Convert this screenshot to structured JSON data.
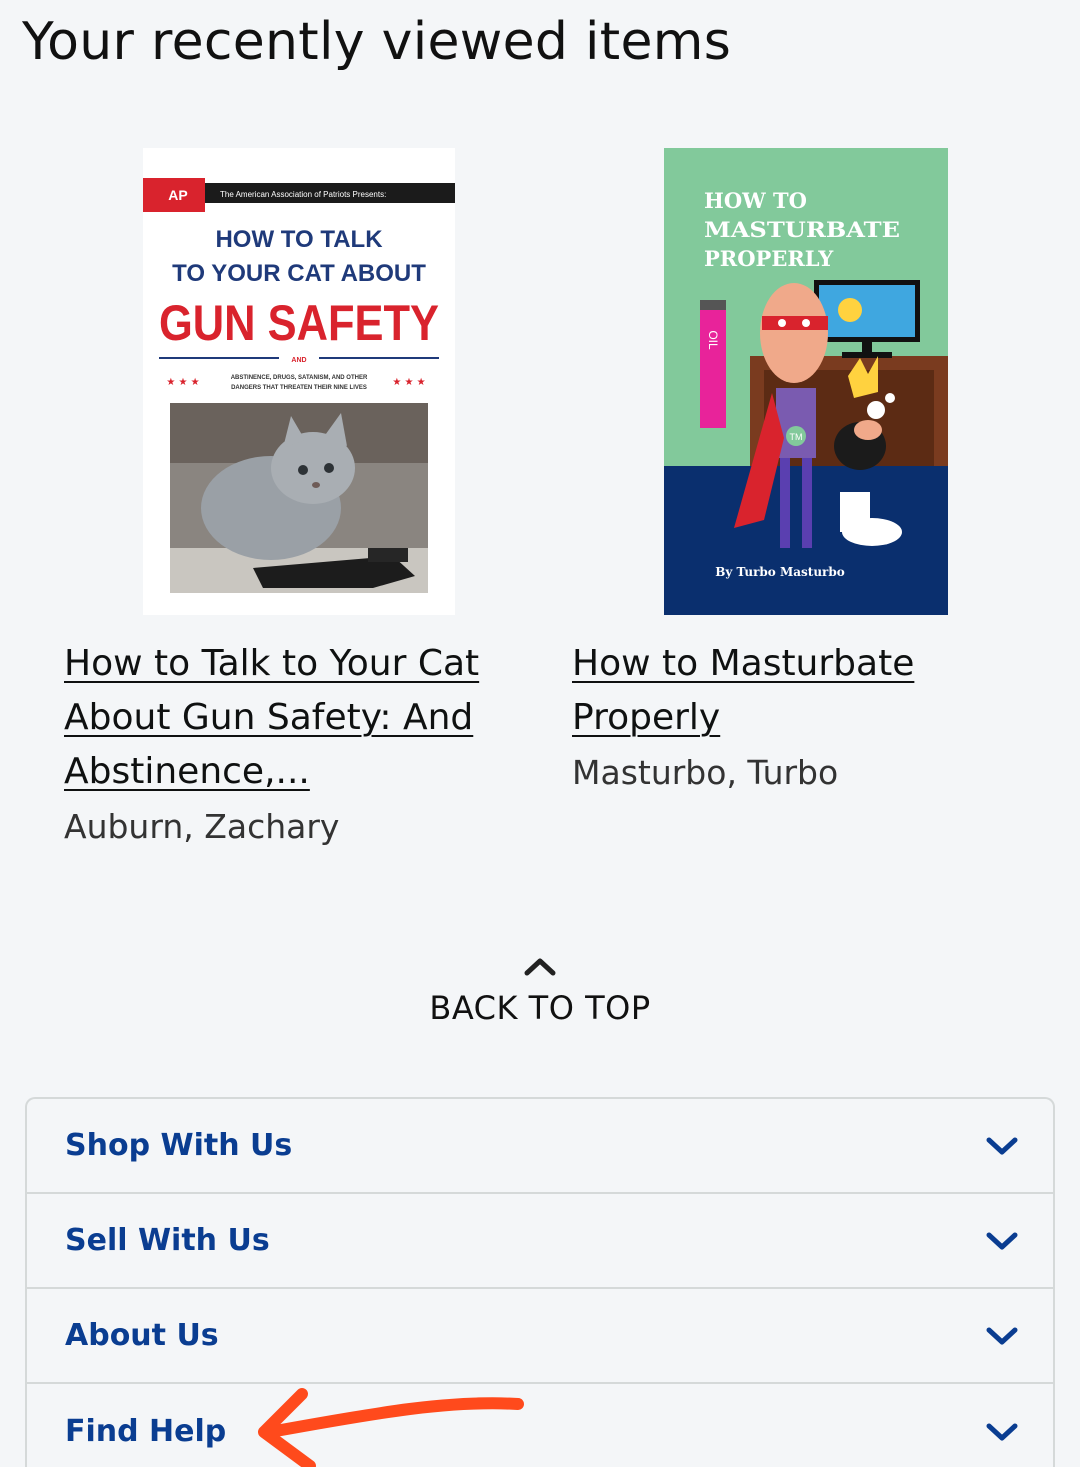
{
  "recently_viewed": {
    "heading": "Your recently viewed items",
    "items": [
      {
        "title": "How to Talk to Your Cat About Gun Safety: And Abstinence,...",
        "author": "Auburn, Zachary",
        "cover": {
          "badge": "AP",
          "banner": "The American Association of Patriots Presents:",
          "line1": "HOW TO TALK",
          "line2": "TO YOUR CAT ABOUT",
          "headline": "GUN SAFETY",
          "and": "AND",
          "sub1": "ABSTINENCE, DRUGS, SATANISM, AND OTHER",
          "sub2": "DANGERS THAT THREATEN THEIR NINE LIVES"
        }
      },
      {
        "title": "How to Masturbate Properly",
        "author": "Masturbo, Turbo",
        "cover": {
          "line1": "HOW TO",
          "line2": "MASTURBATE",
          "line3": "PROPERLY",
          "byline": "By Turbo Masturbo",
          "bottle_text": "OIL",
          "chest_text": "TM"
        }
      }
    ]
  },
  "back_to_top": {
    "label": "BACK TO TOP",
    "icon": "chevron-up-icon"
  },
  "footer_menu": {
    "items": [
      {
        "label": "Shop With Us"
      },
      {
        "label": "Sell With Us"
      },
      {
        "label": "About Us"
      },
      {
        "label": "Find Help"
      }
    ]
  },
  "colors": {
    "link_blue": "#0a3d91",
    "annotation_arrow": "#ff4a1c",
    "cover2_green": "#82c99b",
    "cover2_navy": "#0a2f6e",
    "cover1_red": "#d9232d"
  }
}
